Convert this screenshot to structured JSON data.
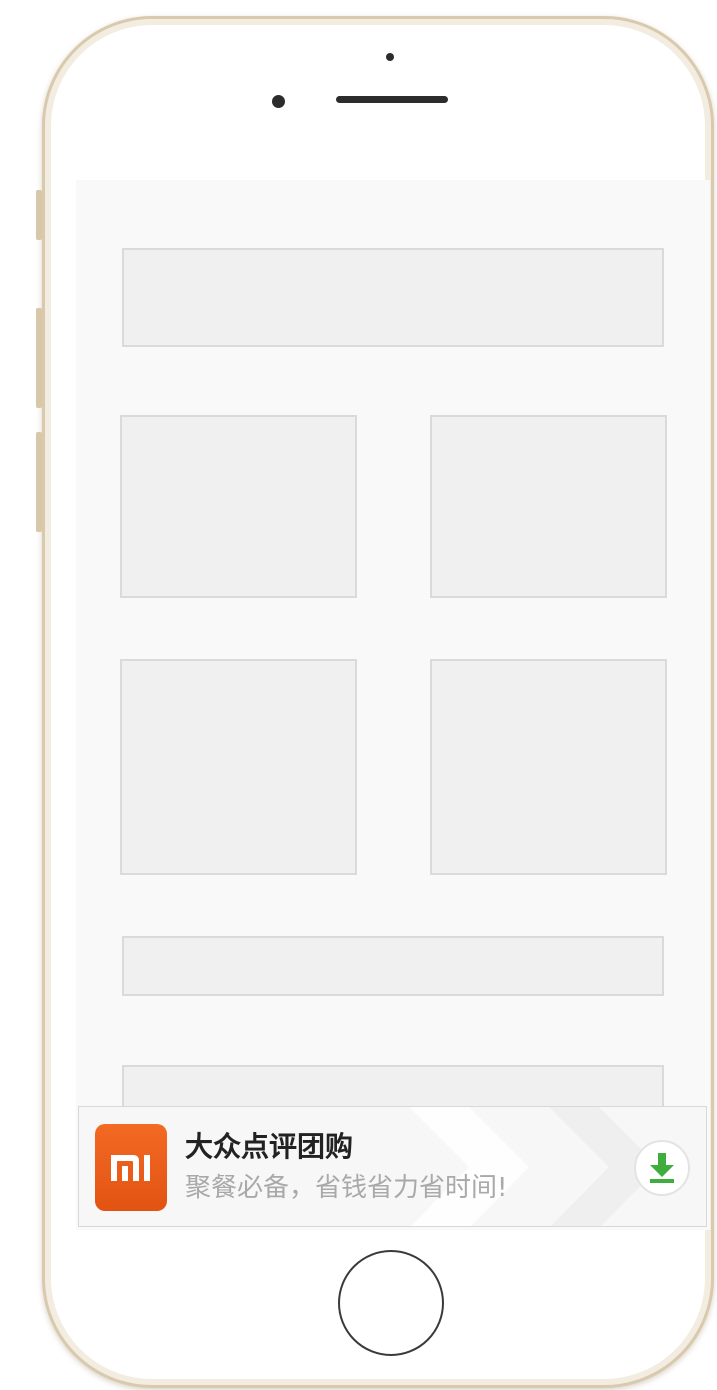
{
  "ad": {
    "title": "大众点评团购",
    "subtitle": "聚餐必备，省钱省力省时间!",
    "logo_icon": "mi-logo-icon",
    "download_icon": "download-arrow-icon",
    "colors": {
      "logo_bg": "#ef6322",
      "download_arrow": "#3fae3f"
    }
  },
  "device": {
    "frame_color": "#d9c9ad"
  }
}
